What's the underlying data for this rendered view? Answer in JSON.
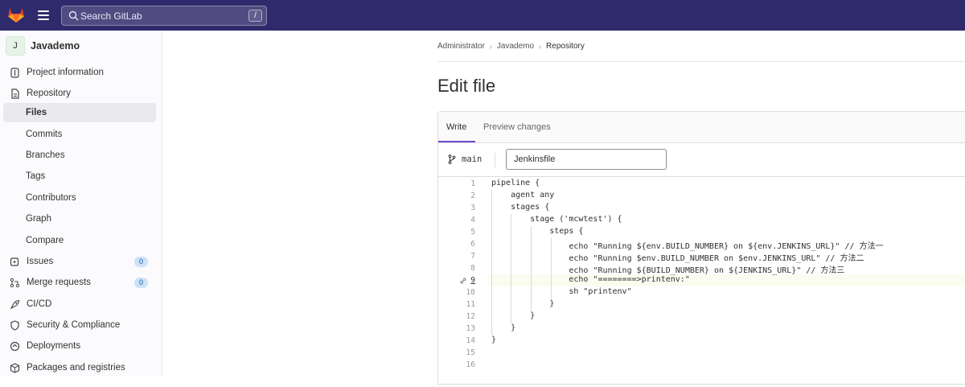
{
  "topbar": {
    "search_placeholder": "Search GitLab",
    "search_shortcut": "/"
  },
  "sidebar": {
    "project": {
      "avatar_letter": "J",
      "name": "Javademo"
    },
    "items": [
      {
        "label": "Project information",
        "icon": "info-icon"
      },
      {
        "label": "Repository",
        "icon": "document-icon"
      },
      {
        "label": "Files",
        "active": true
      },
      {
        "label": "Commits"
      },
      {
        "label": "Branches"
      },
      {
        "label": "Tags"
      },
      {
        "label": "Contributors"
      },
      {
        "label": "Graph"
      },
      {
        "label": "Compare"
      },
      {
        "label": "Issues",
        "icon": "issues-icon",
        "badge": "0"
      },
      {
        "label": "Merge requests",
        "icon": "merge-request-icon",
        "badge": "0"
      },
      {
        "label": "CI/CD",
        "icon": "rocket-icon"
      },
      {
        "label": "Security & Compliance",
        "icon": "shield-icon"
      },
      {
        "label": "Deployments",
        "icon": "deployments-icon"
      },
      {
        "label": "Packages and registries",
        "icon": "package-icon"
      }
    ]
  },
  "breadcrumb": [
    "Administrator",
    "Javademo",
    "Repository"
  ],
  "page_title": "Edit file",
  "editor": {
    "tabs": {
      "write": "Write",
      "preview": "Preview changes"
    },
    "branch": "main",
    "filename": "Jenkinsfile",
    "current_line": 9,
    "lines": [
      "pipeline {",
      "    agent any",
      "    stages {",
      "        stage ('mcwtest') {",
      "            steps {",
      "                echo \"Running ${env.BUILD_NUMBER} on ${env.JENKINS_URL}\" // 方法一",
      "                echo \"Running $env.BUILD_NUMBER on $env.JENKINS_URL\" // 方法二",
      "                echo \"Running ${BUILD_NUMBER} on ${JENKINS_URL}\" // 方法三",
      "                echo \"========>printenv:\"",
      "                sh \"printenv\"",
      "            }",
      "        }",
      "    }",
      "}",
      "",
      ""
    ],
    "line_numbers": [
      "1",
      "2",
      "3",
      "4",
      "5",
      "6",
      "7",
      "8",
      "9",
      "10",
      "11",
      "12",
      "13",
      "14",
      "15",
      "16"
    ]
  },
  "colors": {
    "topbar": "#2f2a6b",
    "accent": "#6e49cb",
    "badge": "#cbe2f9"
  }
}
